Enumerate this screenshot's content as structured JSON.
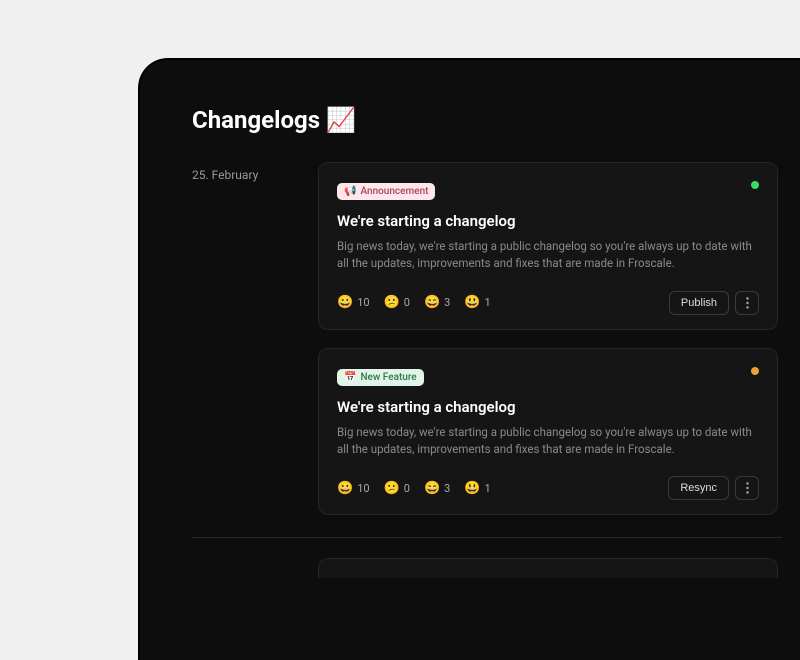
{
  "page": {
    "title": "Changelogs",
    "title_emoji": "📈"
  },
  "date": "25. February",
  "cards": [
    {
      "tag_icon": "📢",
      "tag_label": "Announcement",
      "tag_style": "pink",
      "status": "green",
      "title": "We're starting a changelog",
      "body": "Big news today, we're starting a public changelog so you're always up to date with all the updates, improvements and fixes that are made in Froscale.",
      "reactions": [
        {
          "emoji": "😀",
          "count": "10"
        },
        {
          "emoji": "😕",
          "count": "0"
        },
        {
          "emoji": "😄",
          "count": "3"
        },
        {
          "emoji": "😃",
          "count": "1"
        }
      ],
      "action_label": "Publish"
    },
    {
      "tag_icon": "📅",
      "tag_label": "New Feature",
      "tag_style": "green",
      "status": "orange",
      "title": "We're starting a changelog",
      "body": "Big news today, we're starting a public changelog so you're always up to date with all the updates, improvements and fixes that are made in Froscale.",
      "reactions": [
        {
          "emoji": "😀",
          "count": "10"
        },
        {
          "emoji": "😕",
          "count": "0"
        },
        {
          "emoji": "😄",
          "count": "3"
        },
        {
          "emoji": "😃",
          "count": "1"
        }
      ],
      "action_label": "Resync"
    }
  ]
}
